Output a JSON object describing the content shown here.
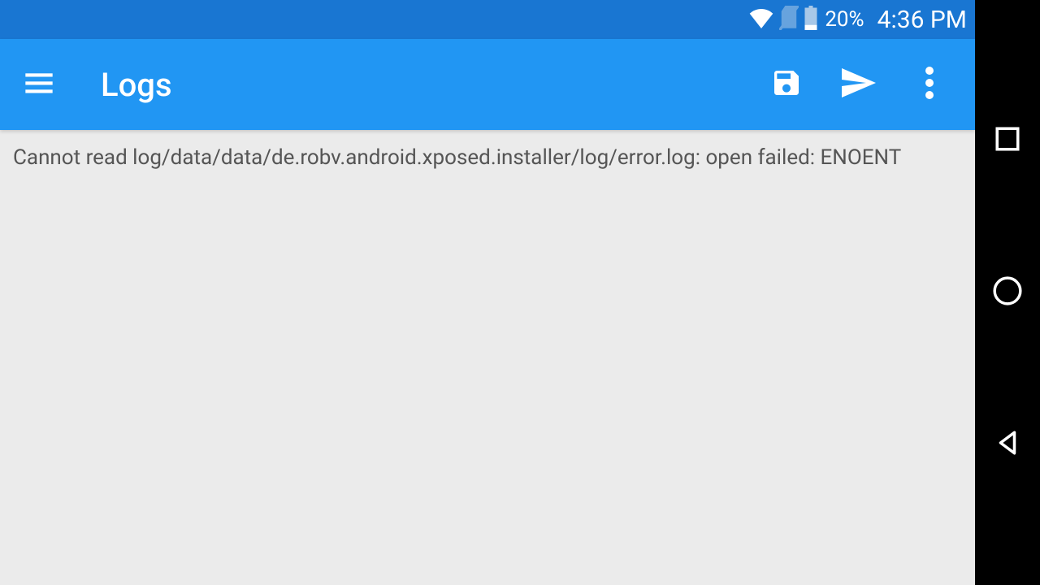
{
  "status": {
    "battery_percent": "20%",
    "time": "4:36 PM"
  },
  "appbar": {
    "title": "Logs"
  },
  "content": {
    "log_message": "Cannot read log/data/data/de.robv.android.xposed.installer/log/error.log: open failed: ENOENT"
  }
}
